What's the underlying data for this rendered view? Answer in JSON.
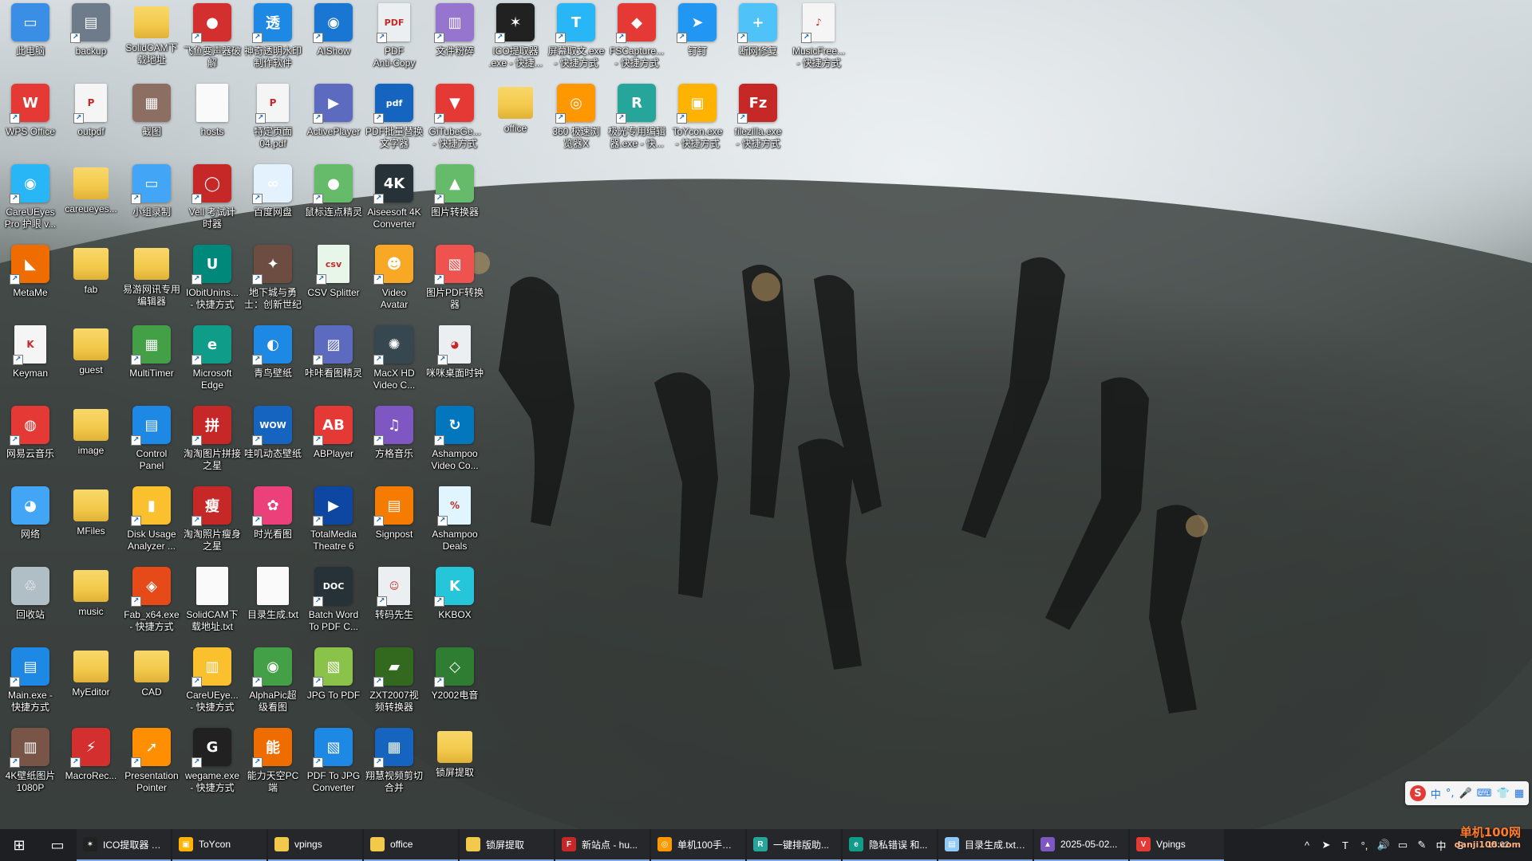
{
  "desktop": {
    "icons": [
      {
        "label": "此电脑",
        "icon": "this-pc-icon",
        "color": "#3a8ee6",
        "glyph": "▭",
        "kind": "app",
        "shortcut": false
      },
      {
        "label": "backup",
        "icon": "printer-icon",
        "color": "#6d7b8a",
        "glyph": "▤",
        "kind": "app",
        "shortcut": true
      },
      {
        "label": "SolidCAM下\n载地址",
        "icon": "folder-icon",
        "color": "#f3c94b",
        "glyph": "",
        "kind": "folder",
        "shortcut": false
      },
      {
        "label": "飞鱼变声器破\n解",
        "icon": "tomato-icon",
        "color": "#d32f2f",
        "glyph": "●",
        "kind": "app",
        "shortcut": true
      },
      {
        "label": "神奇透明水印\n制作软件",
        "icon": "watermark-app-icon",
        "color": "#1e88e5",
        "glyph": "透",
        "kind": "app",
        "shortcut": true
      },
      {
        "label": "AIShow",
        "icon": "penguin-icon",
        "color": "#1976d2",
        "glyph": "◉",
        "kind": "app",
        "shortcut": true
      },
      {
        "label": "PDF\nAnti-Copy",
        "icon": "pdf-lock-icon",
        "color": "#eceff1",
        "glyph": "PDF",
        "kind": "doc",
        "shortcut": true
      },
      {
        "label": "文件粉碎",
        "icon": "shredder-icon",
        "color": "#9575cd",
        "glyph": "▥",
        "kind": "app",
        "shortcut": true
      },
      {
        "label": "ICO提取器\n.exe - 快捷...",
        "icon": "ico-extractor-icon",
        "color": "#212121",
        "glyph": "✶",
        "kind": "app",
        "shortcut": true
      },
      {
        "label": "屏幕取文.exe\n- 快捷方式",
        "icon": "text-capture-icon",
        "color": "#29b6f6",
        "glyph": "T",
        "kind": "app",
        "shortcut": true
      },
      {
        "label": "FSCapture...\n- 快捷方式",
        "icon": "fscapture-icon",
        "color": "#e53935",
        "glyph": "◆",
        "kind": "app",
        "shortcut": true
      },
      {
        "label": "钉钉",
        "icon": "dingtalk-icon",
        "color": "#2196f3",
        "glyph": "➤",
        "kind": "app",
        "shortcut": true
      },
      {
        "label": "断网修复",
        "icon": "network-repair-icon",
        "color": "#4fc3f7",
        "glyph": "+",
        "kind": "app",
        "shortcut": true
      },
      {
        "label": "MusicFree...\n- 快捷方式",
        "icon": "musicfree-icon",
        "color": "#f5f5f5",
        "glyph": "♪",
        "kind": "doc",
        "shortcut": true
      },
      {
        "label": "WPS Office",
        "icon": "wps-icon",
        "color": "#e53935",
        "glyph": "W",
        "kind": "app",
        "shortcut": true
      },
      {
        "label": "outpdf",
        "icon": "pdf-file-icon",
        "color": "#f5f5f5",
        "glyph": "P",
        "kind": "doc",
        "shortcut": true
      },
      {
        "label": "截图",
        "icon": "winrar-icon",
        "color": "#8d6e63",
        "glyph": "▦",
        "kind": "app",
        "shortcut": false
      },
      {
        "label": "hosts",
        "icon": "file-icon",
        "color": "#fafafa",
        "glyph": "",
        "kind": "doc",
        "shortcut": false
      },
      {
        "label": "特定页面\n04.pdf",
        "icon": "pdf-file-icon",
        "color": "#f5f5f5",
        "glyph": "P",
        "kind": "doc",
        "shortcut": true
      },
      {
        "label": "ActivePlayer",
        "icon": "activeplayer-icon",
        "color": "#5c6bc0",
        "glyph": "▶",
        "kind": "app",
        "shortcut": true
      },
      {
        "label": "PDF批量替换\n文字器",
        "icon": "pdf-replace-icon",
        "color": "#1565c0",
        "glyph": "pdf",
        "kind": "app",
        "shortcut": true
      },
      {
        "label": "GiTubeGe...\n- 快捷方式",
        "icon": "tubeget-icon",
        "color": "#e53935",
        "glyph": "▼",
        "kind": "app",
        "shortcut": true
      },
      {
        "label": "office",
        "icon": "folder-icon",
        "color": "#f3c94b",
        "glyph": "",
        "kind": "folder",
        "shortcut": false
      },
      {
        "label": "360 极速浏\n览器X",
        "icon": "360-browser-icon",
        "color": "#ff9800",
        "glyph": "◎",
        "kind": "app",
        "shortcut": true
      },
      {
        "label": "极光专用编辑\n器.exe - 快...",
        "icon": "editor-r-icon",
        "color": "#26a69a",
        "glyph": "R",
        "kind": "app",
        "shortcut": true
      },
      {
        "label": "ToYcon.exe\n- 快捷方式",
        "icon": "toycon-icon",
        "color": "#ffb300",
        "glyph": "▣",
        "kind": "app",
        "shortcut": true
      },
      {
        "label": "filezilla.exe\n- 快捷方式",
        "icon": "filezilla-icon",
        "color": "#c62828",
        "glyph": "Fz",
        "kind": "app",
        "shortcut": true
      },
      {
        "label": "CareUEyes\nPro 护眼 v...",
        "icon": "eye-icon",
        "color": "#29b6f6",
        "glyph": "◉",
        "kind": "app",
        "shortcut": true
      },
      {
        "label": "careueyes...",
        "icon": "folder-icon",
        "color": "#f3c94b",
        "glyph": "",
        "kind": "folder",
        "shortcut": false
      },
      {
        "label": "小组录制",
        "icon": "laptop-icon",
        "color": "#42a5f5",
        "glyph": "▭",
        "kind": "app",
        "shortcut": true
      },
      {
        "label": "Vell 考试计\n时器",
        "icon": "timer-icon",
        "color": "#c62828",
        "glyph": "◯",
        "kind": "app",
        "shortcut": true
      },
      {
        "label": "百度网盘",
        "icon": "baidu-netdisk-icon",
        "color": "#e3f2fd",
        "glyph": "∞",
        "kind": "app",
        "shortcut": true
      },
      {
        "label": "鼠标连点精灵",
        "icon": "mouse-icon",
        "color": "#66bb6a",
        "glyph": "●",
        "kind": "app",
        "shortcut": true
      },
      {
        "label": "Aiseesoft 4K\nConverter",
        "icon": "aiseesoft-icon",
        "color": "#263238",
        "glyph": "4K",
        "kind": "app",
        "shortcut": true
      },
      {
        "label": "图片转换器",
        "icon": "image-convert-icon",
        "color": "#66bb6a",
        "glyph": "▲",
        "kind": "app",
        "shortcut": true
      },
      {
        "label": "MetaMe",
        "icon": "fox-icon",
        "color": "#ef6c00",
        "glyph": "◣",
        "kind": "app",
        "shortcut": true
      },
      {
        "label": "fab",
        "icon": "folder-icon",
        "color": "#f3c94b",
        "glyph": "",
        "kind": "folder",
        "shortcut": false
      },
      {
        "label": "易游网讯专用\n编辑器",
        "icon": "folder-zip-icon",
        "color": "#f3c94b",
        "glyph": "",
        "kind": "folder",
        "shortcut": false
      },
      {
        "label": "IObitUnins...\n- 快捷方式",
        "icon": "iobit-icon",
        "color": "#00897b",
        "glyph": "U",
        "kind": "app",
        "shortcut": true
      },
      {
        "label": "地下城与勇\n士：创新世纪",
        "icon": "dnf-icon",
        "color": "#6d4c41",
        "glyph": "✦",
        "kind": "app",
        "shortcut": true
      },
      {
        "label": "CSV Splitter",
        "icon": "csv-icon",
        "color": "#e8f5e9",
        "glyph": "csv",
        "kind": "doc",
        "shortcut": true
      },
      {
        "label": "Video\nAvatar",
        "icon": "video-avatar-icon",
        "color": "#f9a825",
        "glyph": "☻",
        "kind": "app",
        "shortcut": true
      },
      {
        "label": "图片PDF转换\n器",
        "icon": "image-pdf-icon",
        "color": "#ef5350",
        "glyph": "▧",
        "kind": "app",
        "shortcut": true
      },
      {
        "label": "Keyman",
        "icon": "keyman-icon",
        "color": "#f5f5f5",
        "glyph": "K",
        "kind": "doc",
        "shortcut": true
      },
      {
        "label": "guest",
        "icon": "folder-icon",
        "color": "#f3c94b",
        "glyph": "",
        "kind": "folder",
        "shortcut": false
      },
      {
        "label": "MultiTimer",
        "icon": "multitimer-icon",
        "color": "#43a047",
        "glyph": "▦",
        "kind": "app",
        "shortcut": true
      },
      {
        "label": "Microsoft\nEdge",
        "icon": "edge-icon",
        "color": "#0f9d8a",
        "glyph": "e",
        "kind": "app",
        "shortcut": true
      },
      {
        "label": "青鸟壁纸",
        "icon": "wallpaper-icon",
        "color": "#1e88e5",
        "glyph": "◐",
        "kind": "app",
        "shortcut": true
      },
      {
        "label": "咔咔看图精灵",
        "icon": "photo-viewer-icon",
        "color": "#5c6bc0",
        "glyph": "▨",
        "kind": "app",
        "shortcut": true
      },
      {
        "label": "MacX HD\nVideo C...",
        "icon": "film-reel-icon",
        "color": "#37474f",
        "glyph": "✺",
        "kind": "app",
        "shortcut": true
      },
      {
        "label": "咪咪桌面时钟",
        "icon": "cat-clock-icon",
        "color": "#eceff1",
        "glyph": "◕",
        "kind": "doc",
        "shortcut": true
      },
      {
        "label": "网易云音乐",
        "icon": "netease-music-icon",
        "color": "#e53935",
        "glyph": "◍",
        "kind": "app",
        "shortcut": true
      },
      {
        "label": "image",
        "icon": "folder-image-icon",
        "color": "#f3c94b",
        "glyph": "",
        "kind": "folder",
        "shortcut": false
      },
      {
        "label": "Control\nPanel",
        "icon": "control-panel-icon",
        "color": "#1e88e5",
        "glyph": "▤",
        "kind": "app",
        "shortcut": true
      },
      {
        "label": "淘淘图片拼接\n之星",
        "icon": "image-stitch-icon",
        "color": "#c62828",
        "glyph": "拼",
        "kind": "app",
        "shortcut": true
      },
      {
        "label": "哇叽动态壁纸",
        "icon": "wow-wallpaper-icon",
        "color": "#1565c0",
        "glyph": "WOW",
        "kind": "app",
        "shortcut": true
      },
      {
        "label": "ABPlayer",
        "icon": "abplayer-icon",
        "color": "#e53935",
        "glyph": "AB",
        "kind": "app",
        "shortcut": true
      },
      {
        "label": "方格音乐",
        "icon": "grid-music-icon",
        "color": "#7e57c2",
        "glyph": "♫",
        "kind": "app",
        "shortcut": true
      },
      {
        "label": "Ashampoo\nVideo Co...",
        "icon": "ashampoo-video-icon",
        "color": "#0277bd",
        "glyph": "↻",
        "kind": "app",
        "shortcut": true
      },
      {
        "label": "网络",
        "icon": "network-icon",
        "color": "#42a5f5",
        "glyph": "◕",
        "kind": "app",
        "shortcut": false
      },
      {
        "label": "MFiles",
        "icon": "folder-icon",
        "color": "#f3c94b",
        "glyph": "",
        "kind": "folder",
        "shortcut": false
      },
      {
        "label": "Disk Usage\nAnalyzer ...",
        "icon": "disk-usage-icon",
        "color": "#fbc02d",
        "glyph": "▮",
        "kind": "app",
        "shortcut": true
      },
      {
        "label": "淘淘照片瘦身\n之星",
        "icon": "photo-slim-icon",
        "color": "#c62828",
        "glyph": "瘦",
        "kind": "app",
        "shortcut": true
      },
      {
        "label": "时光看图",
        "icon": "time-viewer-icon",
        "color": "#ec407a",
        "glyph": "✿",
        "kind": "app",
        "shortcut": true
      },
      {
        "label": "TotalMedia\nTheatre 6",
        "icon": "totalmedia-icon",
        "color": "#0d47a1",
        "glyph": "▶",
        "kind": "app",
        "shortcut": true
      },
      {
        "label": "Signpost",
        "icon": "signpost-icon",
        "color": "#f57c00",
        "glyph": "▤",
        "kind": "app",
        "shortcut": true
      },
      {
        "label": "Ashampoo\nDeals",
        "icon": "ashampoo-deals-icon",
        "color": "#e1f5fe",
        "glyph": "%",
        "kind": "doc",
        "shortcut": true
      },
      {
        "label": "回收站",
        "icon": "recycle-bin-icon",
        "color": "#b0bec5",
        "glyph": "♲",
        "kind": "app",
        "shortcut": false
      },
      {
        "label": "music",
        "icon": "folder-music-icon",
        "color": "#f3c94b",
        "glyph": "",
        "kind": "folder",
        "shortcut": false
      },
      {
        "label": "Fab_x64.exe\n- 快捷方式",
        "icon": "fab-firewall-icon",
        "color": "#e64a19",
        "glyph": "◈",
        "kind": "app",
        "shortcut": true
      },
      {
        "label": "SolidCAM下\n载地址.txt",
        "icon": "txt-file-icon",
        "color": "#fafafa",
        "glyph": "",
        "kind": "doc",
        "shortcut": false
      },
      {
        "label": "目录生成.txt",
        "icon": "txt-file-icon",
        "color": "#fafafa",
        "glyph": "",
        "kind": "doc",
        "shortcut": false
      },
      {
        "label": "Batch Word\nTo PDF C...",
        "icon": "word-pdf-icon",
        "color": "#263238",
        "glyph": "DOC",
        "kind": "app",
        "shortcut": true
      },
      {
        "label": "转码先生",
        "icon": "transcode-icon",
        "color": "#eceff1",
        "glyph": "☺",
        "kind": "doc",
        "shortcut": true
      },
      {
        "label": "KKBOX",
        "icon": "kkbox-icon",
        "color": "#26c6da",
        "glyph": "K",
        "kind": "app",
        "shortcut": true
      },
      {
        "label": "Main.exe -\n快捷方式",
        "icon": "main-exe-icon",
        "color": "#1e88e5",
        "glyph": "▤",
        "kind": "app",
        "shortcut": true
      },
      {
        "label": "MyEditor",
        "icon": "folder-icon",
        "color": "#f3c94b",
        "glyph": "",
        "kind": "folder",
        "shortcut": false
      },
      {
        "label": "CAD",
        "icon": "folder-icon",
        "color": "#f3c94b",
        "glyph": "",
        "kind": "folder",
        "shortcut": false
      },
      {
        "label": "CareUEye...\n- 快捷方式",
        "icon": "archive-icon",
        "color": "#fbc02d",
        "glyph": "▥",
        "kind": "app",
        "shortcut": true
      },
      {
        "label": "AlphaPic超\n级看图",
        "icon": "alphapic-icon",
        "color": "#43a047",
        "glyph": "◉",
        "kind": "app",
        "shortcut": true
      },
      {
        "label": "JPG To PDF",
        "icon": "jpg-pdf-icon",
        "color": "#8bc34a",
        "glyph": "▧",
        "kind": "app",
        "shortcut": true
      },
      {
        "label": "ZXT2007视\n频转换器",
        "icon": "video-convert-icon",
        "color": "#33691e",
        "glyph": "▰",
        "kind": "app",
        "shortcut": true
      },
      {
        "label": "Y2002电音",
        "icon": "y2002-icon",
        "color": "#2e7d32",
        "glyph": "◇",
        "kind": "app",
        "shortcut": true
      },
      {
        "label": "4K壁纸图片\n1080P",
        "icon": "archive-icon",
        "color": "#795548",
        "glyph": "▥",
        "kind": "app",
        "shortcut": true
      },
      {
        "label": "MacroRec...",
        "icon": "macro-recorder-icon",
        "color": "#d32f2f",
        "glyph": "⚡",
        "kind": "app",
        "shortcut": true
      },
      {
        "label": "Presentation\nPointer",
        "icon": "pointer-icon",
        "color": "#ff8f00",
        "glyph": "➚",
        "kind": "app",
        "shortcut": true
      },
      {
        "label": "wegame.exe\n- 快捷方式",
        "icon": "wegame-icon",
        "color": "#212121",
        "glyph": "G",
        "kind": "app",
        "shortcut": true
      },
      {
        "label": "能力天空PC\n端",
        "icon": "ability-sky-icon",
        "color": "#ef6c00",
        "glyph": "能",
        "kind": "app",
        "shortcut": true
      },
      {
        "label": "PDF To JPG\nConverter",
        "icon": "pdf-jpg-icon",
        "color": "#1e88e5",
        "glyph": "▧",
        "kind": "app",
        "shortcut": true
      },
      {
        "label": "翔慧视频剪切\n合并",
        "icon": "video-cut-icon",
        "color": "#1565c0",
        "glyph": "▦",
        "kind": "app",
        "shortcut": true
      },
      {
        "label": "锁屏提取",
        "icon": "folder-lock-icon",
        "color": "#f3c94b",
        "glyph": "",
        "kind": "folder",
        "shortcut": false
      }
    ]
  },
  "ime": {
    "logo": "S",
    "items": [
      "中",
      "°,",
      "🎤",
      "⌨",
      "👕",
      "▦"
    ]
  },
  "taskbar": {
    "start_glyph": "⊞",
    "taskview_glyph": "▭",
    "tasks": [
      {
        "label": "ICO提取器 V...",
        "icon": "ico-extractor-icon",
        "color": "#212121",
        "glyph": "✶"
      },
      {
        "label": "ToYcon",
        "icon": "toycon-icon",
        "color": "#ffb300",
        "glyph": "▣"
      },
      {
        "label": "vpings",
        "icon": "folder-icon",
        "color": "#f3c94b",
        "glyph": ""
      },
      {
        "label": "office",
        "icon": "folder-icon",
        "color": "#f3c94b",
        "glyph": ""
      },
      {
        "label": "锁屏提取",
        "icon": "folder-icon",
        "color": "#f3c94b",
        "glyph": ""
      },
      {
        "label": "新站点 - hu...",
        "icon": "filezilla-icon",
        "color": "#c62828",
        "glyph": "F"
      },
      {
        "label": "单机100手游...",
        "icon": "360-browser-icon",
        "color": "#ff9800",
        "glyph": "◎"
      },
      {
        "label": "一键排版助...",
        "icon": "editor-r-icon",
        "color": "#26a69a",
        "glyph": "R"
      },
      {
        "label": "隐私错误 和...",
        "icon": "edge-icon",
        "color": "#0f9d8a",
        "glyph": "e"
      },
      {
        "label": "目录生成.txt ...",
        "icon": "notepad-icon",
        "color": "#90caf9",
        "glyph": "▤"
      },
      {
        "label": "2025-05-02...",
        "icon": "photo-editor-icon",
        "color": "#7e57c2",
        "glyph": "▲"
      },
      {
        "label": "Vpings",
        "icon": "vpings-icon",
        "color": "#e53935",
        "glyph": "V"
      }
    ],
    "tray": [
      "^",
      "➤",
      "T",
      "°,",
      "🔊",
      "▭",
      "✎",
      "中",
      "S"
    ],
    "clock_time": "15:02",
    "watermark_line1": "单机100网",
    "watermark_line2": "danji100.com"
  }
}
